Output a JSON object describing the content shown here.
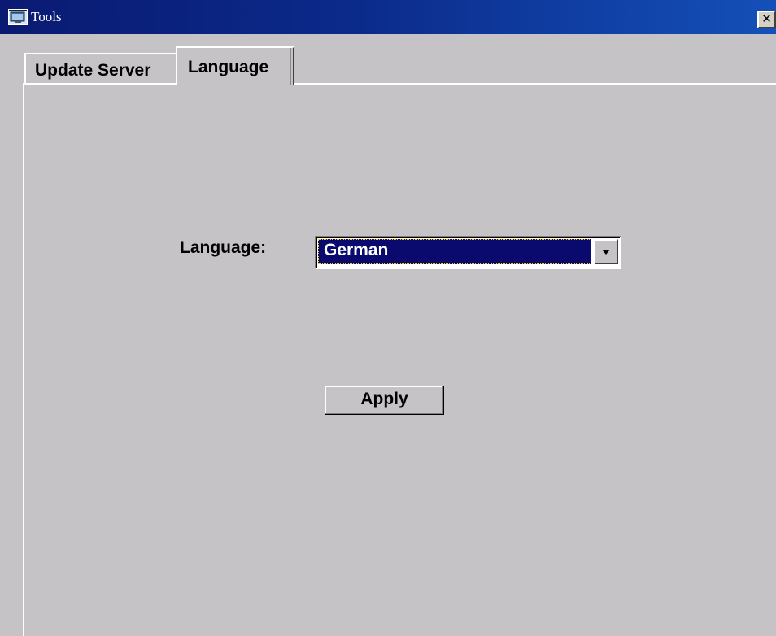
{
  "window": {
    "title": "Tools",
    "icon": "app-monitor-icon",
    "close_glyph": "✕"
  },
  "tabs": [
    {
      "label": "Update Server",
      "selected": false
    },
    {
      "label": "Language",
      "selected": true
    }
  ],
  "language_form": {
    "label": "Language:",
    "selected_value": "German"
  },
  "actions": {
    "apply_label": "Apply"
  },
  "colors": {
    "titlebar_start": "#0a1a72",
    "titlebar_end": "#1450b8",
    "face": "#c6c3c6",
    "selection": "#0a0a6e"
  }
}
